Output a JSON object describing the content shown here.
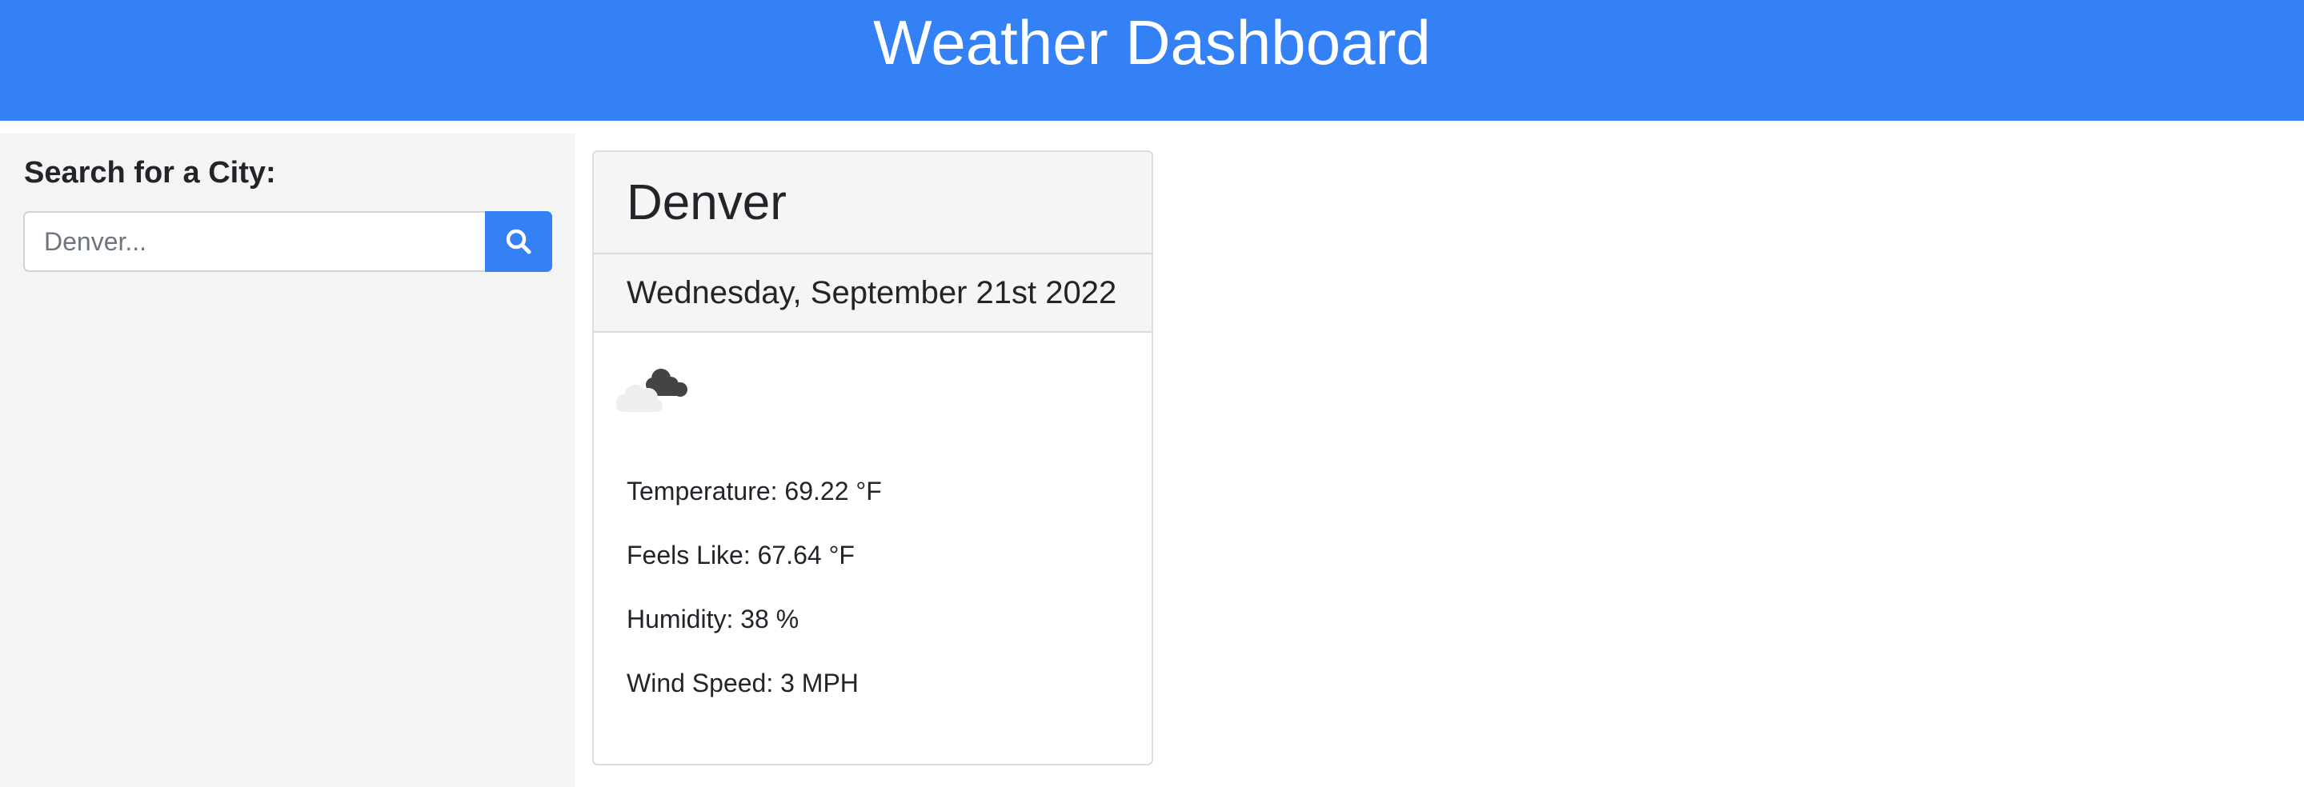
{
  "header": {
    "title": "Weather Dashboard"
  },
  "sidebar": {
    "search_label": "Search for a City:",
    "search_placeholder": "Denver...",
    "search_value": "",
    "search_button_icon": "search-icon"
  },
  "weather": {
    "city": "Denver",
    "date": "Wednesday, September 21st 2022",
    "icon": "partly-cloudy-night-icon",
    "temperature": "Temperature: 69.22 °F",
    "feels_like": "Feels Like: 67.64 °F",
    "humidity": "Humidity: 38 %",
    "wind_speed": "Wind Speed: 3 MPH"
  },
  "colors": {
    "header_bg": "#3381f5",
    "sidebar_bg": "#f4f4f4",
    "accent": "#3381f5"
  }
}
